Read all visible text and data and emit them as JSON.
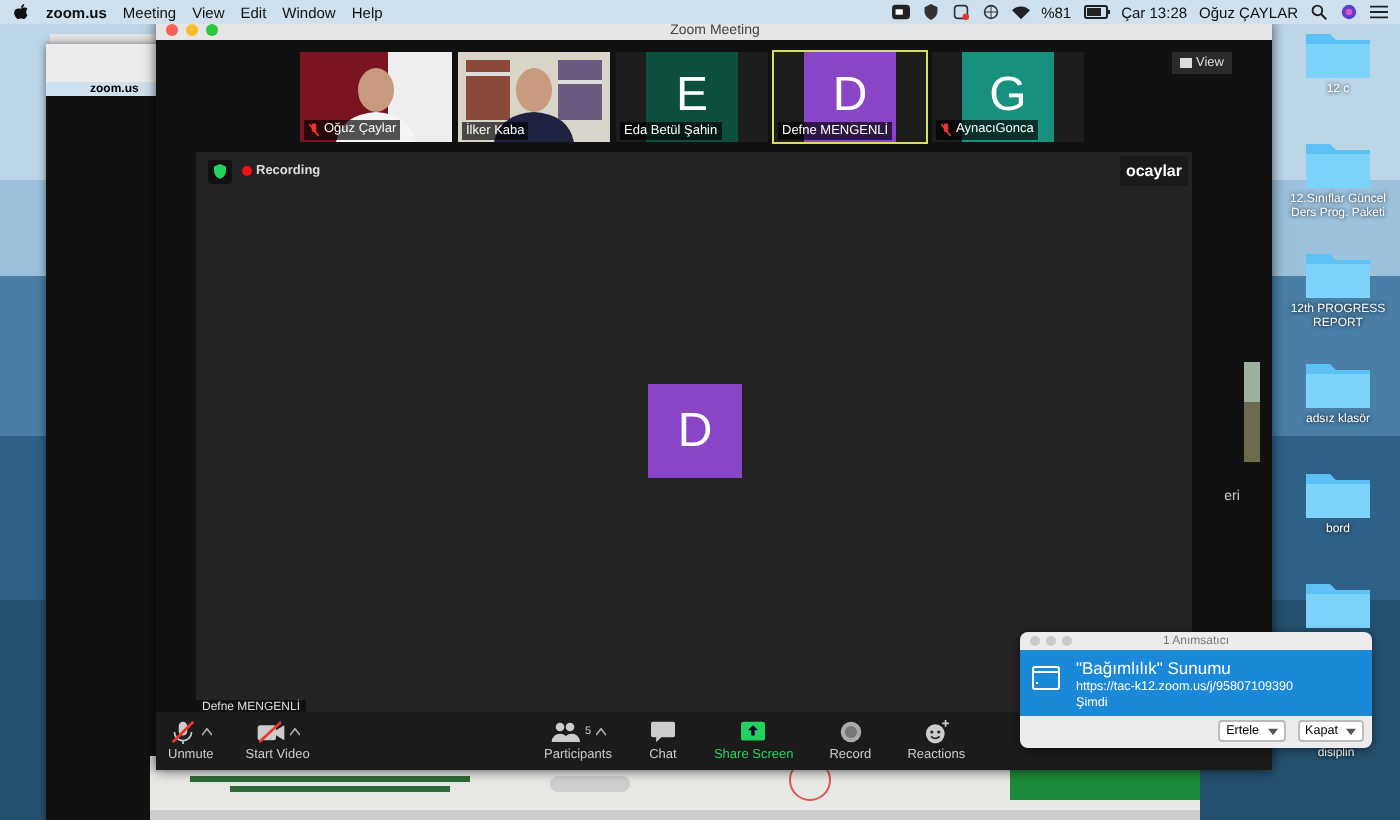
{
  "menubar": {
    "app": "zoom.us",
    "menus": [
      "Meeting",
      "View",
      "Edit",
      "Window",
      "Help"
    ],
    "battery": "%81",
    "clock": "Çar 13:28",
    "user": "Oğuz ÇAYLAR"
  },
  "back_window": {
    "app": "zoom.us"
  },
  "window": {
    "title": "Zoom Meeting"
  },
  "thumbnails": [
    {
      "name": "Oğuz Çaylar",
      "kind": "video",
      "muted": true,
      "selected": false
    },
    {
      "name": "İlker Kaba",
      "kind": "video",
      "muted": false,
      "selected": false
    },
    {
      "name": "Eda Betül Şahin",
      "kind": "avatar",
      "initial": "E",
      "color": "#0d4f3f",
      "muted": false,
      "selected": false
    },
    {
      "name": "Defne MENGENLİ",
      "kind": "avatar",
      "initial": "D",
      "color": "#8a45c6",
      "muted": false,
      "selected": true
    },
    {
      "name": "AynacıGonca",
      "kind": "avatar",
      "initial": "G",
      "color": "#17917e",
      "muted": true,
      "selected": false
    }
  ],
  "view_button": "View",
  "stage": {
    "recording": "Recording",
    "host_label": "ocaylar",
    "initial": "D",
    "tooltip": "Defne MENGENLİ"
  },
  "toolbar_left": [
    {
      "label": "Unmute",
      "kind": "mic"
    },
    {
      "label": "Start Video",
      "kind": "video"
    }
  ],
  "toolbar_center": [
    {
      "label": "Participants",
      "kind": "participants",
      "count": "5"
    },
    {
      "label": "Chat",
      "kind": "chat"
    },
    {
      "label": "Share Screen",
      "kind": "share"
    },
    {
      "label": "Record",
      "kind": "record"
    },
    {
      "label": "Reactions",
      "kind": "reactions"
    }
  ],
  "side_text": "eri",
  "desktop_icons": [
    {
      "label": "12 c"
    },
    {
      "label": "12.Sınıflar Güncel Ders Prog. Paketi"
    },
    {
      "label": "12th PROGRESS REPORT"
    },
    {
      "label": "adsız klasör"
    },
    {
      "label": "bord"
    }
  ],
  "desktop_hidden_label": "disiplin",
  "notification": {
    "title": "1 Anımsatıcı",
    "event": "\"Bağımlılık\" Sunumu",
    "url": "https://tac-k12.zoom.us/j/95807109390",
    "time": "Şimdi",
    "buttons": [
      "Ertele",
      "Kapat"
    ]
  }
}
